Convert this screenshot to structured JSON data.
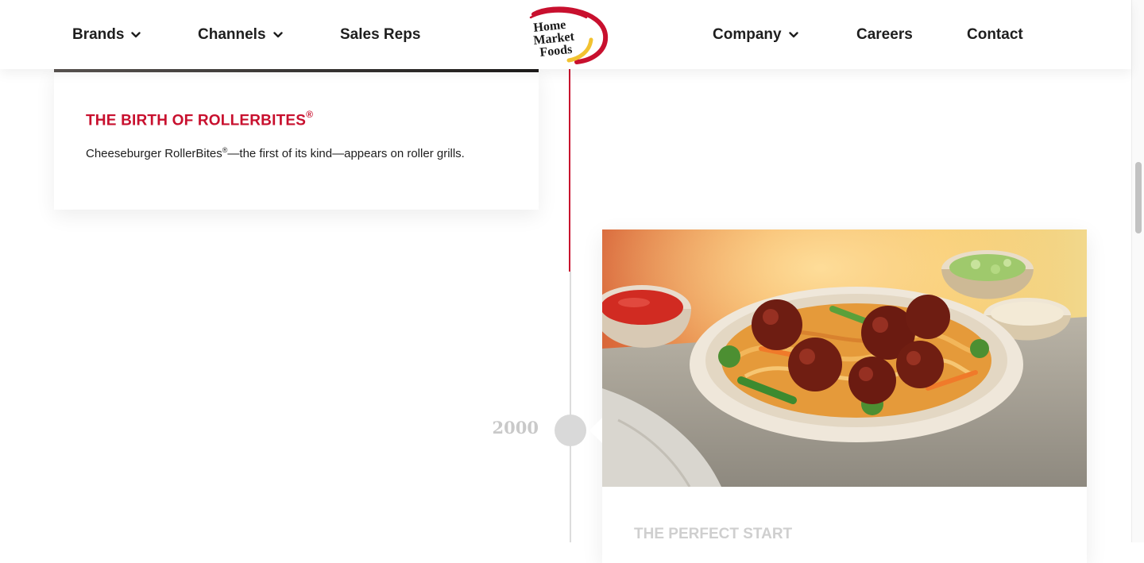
{
  "nav": {
    "brands": "Brands",
    "channels": "Channels",
    "sales_reps": "Sales Reps",
    "company": "Company",
    "careers": "Careers",
    "contact": "Contact"
  },
  "logo": {
    "line1": "Home",
    "line2": "Market",
    "line3": "Foods"
  },
  "timeline": {
    "card1": {
      "title": "THE BIRTH OF ROLLERBITES",
      "title_mark": "®",
      "text_a": "Cheeseburger RollerBites",
      "text_mark": "®",
      "text_b": "—the first of its kind—appears on roller grills."
    },
    "marker_year": "2000",
    "card2": {
      "title": "THE PERFECT START"
    }
  },
  "colors": {
    "brand_red": "#c8102e",
    "brand_yellow": "#f2c230",
    "line_grey": "#dcdcdc"
  }
}
